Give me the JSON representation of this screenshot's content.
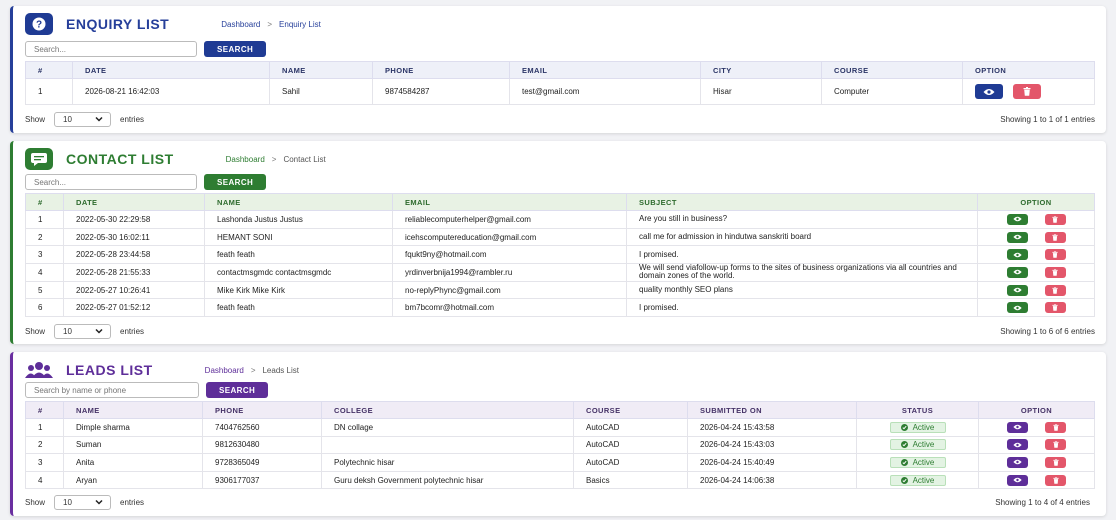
{
  "enquiry": {
    "title": "ENQUIRY LIST",
    "breadcrumb": [
      "Dashboard",
      "Enquiry List"
    ],
    "search_placeholder": "Search...",
    "search_button": "SEARCH",
    "columns": [
      "#",
      "DATE",
      "NAME",
      "PHONE",
      "EMAIL",
      "CITY",
      "COURSE",
      "OPTION"
    ],
    "rows": [
      {
        "num": "1",
        "date": "2026-08-21 16:42:03",
        "name": "Sahil",
        "phone": "9874584287",
        "email": "test@gmail.com",
        "city": "Hisar",
        "course": "Computer"
      }
    ],
    "show_label": "Show",
    "entries_value": "10",
    "entries_label": "entries",
    "info": "Showing 1 to 1 of 1 entries",
    "accent": "#263f9a"
  },
  "contact": {
    "title": "CONTACT LIST",
    "breadcrumb": [
      "Dashboard",
      "Contact List"
    ],
    "search_placeholder": "Search...",
    "search_button": "SEARCH",
    "columns": [
      "#",
      "DATE",
      "NAME",
      "EMAIL",
      "SUBJECT",
      "OPTION"
    ],
    "rows": [
      {
        "num": "1",
        "date": "2022-05-30 22:29:58",
        "name": "Lashonda Justus Justus",
        "email": "reliablecomputerhelper@gmail.com",
        "subject": "Are you still in business?"
      },
      {
        "num": "2",
        "date": "2022-05-30 16:02:11",
        "name": "HEMANT SONI",
        "email": "icehscomputereducation@gmail.com",
        "subject": "call me for admission in hindutwa sanskriti board"
      },
      {
        "num": "3",
        "date": "2022-05-28 23:44:58",
        "name": "feath feath",
        "email": "fqukt9ny@hotmail.com",
        "subject": "I promised."
      },
      {
        "num": "4",
        "date": "2022-05-28 21:55:33",
        "name": "contactmsgmdc contactmsgmdc",
        "email": "yrdinverbnija1994@rambler.ru",
        "subject": "We will send viafollow-up forms to the sites of business organizations via all countries and domain zones of the world."
      },
      {
        "num": "5",
        "date": "2022-05-27 10:26:41",
        "name": "Mike Kirk Mike Kirk",
        "email": "no-replyPhync@gmail.com",
        "subject": "quality monthly SEO plans"
      },
      {
        "num": "6",
        "date": "2022-05-27 01:52:12",
        "name": "feath feath",
        "email": "bm7bcomr@hotmail.com",
        "subject": "I promised."
      }
    ],
    "show_label": "Show",
    "entries_value": "10",
    "entries_label": "entries",
    "info": "Showing 1 to 6 of 6 entries",
    "accent": "#2e7d32"
  },
  "leads": {
    "title": "LEADS LIST",
    "breadcrumb": [
      "Dashboard",
      "Leads List"
    ],
    "search_placeholder": "Search by name or phone",
    "search_button": "SEARCH",
    "columns": [
      "#",
      "NAME",
      "PHONE",
      "COLLEGE",
      "COURSE",
      "SUBMITTED ON",
      "STATUS",
      "OPTION"
    ],
    "rows": [
      {
        "num": "1",
        "name": "Dimple sharma",
        "phone": "7404762560",
        "college": "DN collage",
        "course": "AutoCAD",
        "submitted": "2026-04-24 15:43:58",
        "status": "Active"
      },
      {
        "num": "2",
        "name": "Suman",
        "phone": "9812630480",
        "college": "",
        "course": "AutoCAD",
        "submitted": "2026-04-24 15:43:03",
        "status": "Active"
      },
      {
        "num": "3",
        "name": "Anita",
        "phone": "9728365049",
        "college": "Polytechnic hisar",
        "course": "AutoCAD",
        "submitted": "2026-04-24 15:40:49",
        "status": "Active"
      },
      {
        "num": "4",
        "name": "Aryan",
        "phone": "9306177037",
        "college": "Guru deksh Government polytechnic hisar",
        "course": "Basics",
        "submitted": "2026-04-24 14:06:38",
        "status": "Active"
      }
    ],
    "show_label": "Show",
    "entries_value": "10",
    "entries_label": "entries",
    "info": "Showing 1 to 4 of 4 entries",
    "accent": "#5e2e99"
  },
  "icons": {
    "enquiry": "question-icon",
    "contact": "chat-icon",
    "leads": "users-icon",
    "view": "eye-icon",
    "delete": "trash-icon",
    "status": "check-circle-icon",
    "dropdown": "chevron-down-icon"
  }
}
